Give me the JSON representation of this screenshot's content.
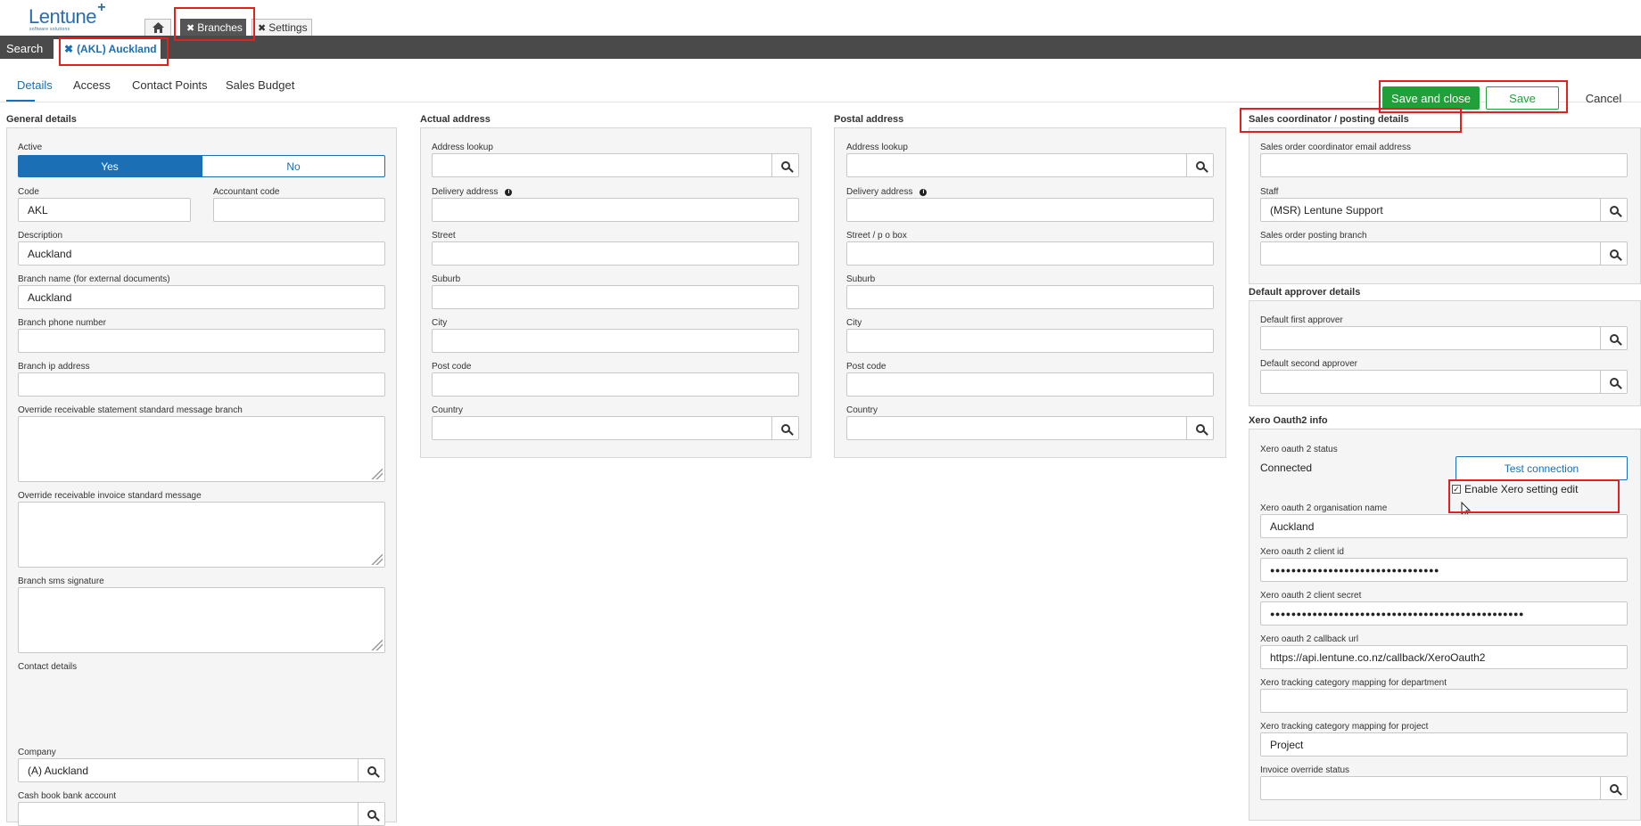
{
  "app": {
    "logo": "Lentune",
    "logo_plus": "+",
    "logo_sub": "software solutions"
  },
  "top_tabs": [
    {
      "label": "Branches"
    },
    {
      "label": "Settings"
    }
  ],
  "bar": {
    "search_label": "Search",
    "open_tab_label": "(AKL) Auckland"
  },
  "subtabs": [
    {
      "label": "Details"
    },
    {
      "label": "Access"
    },
    {
      "label": "Contact Points"
    },
    {
      "label": "Sales Budget"
    }
  ],
  "actions": {
    "save_close": "Save and close",
    "save": "Save",
    "cancel": "Cancel"
  },
  "general": {
    "title": "General details",
    "active_label": "Active",
    "active_yes": "Yes",
    "active_no": "No",
    "active_value": "Yes",
    "code_label": "Code",
    "code_value": "AKL",
    "accountant_code_label": "Accountant code",
    "accountant_code_value": "",
    "description_label": "Description",
    "description_value": "Auckland",
    "branch_name_label": "Branch name (for external documents)",
    "branch_name_value": "Auckland",
    "phone_label": "Branch phone number",
    "ip_label": "Branch ip address",
    "override_statement_label": "Override receivable statement standard message branch",
    "override_invoice_label": "Override receivable invoice standard message",
    "sms_label": "Branch sms signature",
    "contact_details_label": "Contact details",
    "company_label": "Company",
    "company_value": "(A) Auckland",
    "cashbook_label": "Cash book bank account"
  },
  "actual_address": {
    "title": "Actual address",
    "lookup_label": "Address lookup",
    "delivery_label": "Delivery address",
    "street_label": "Street",
    "suburb_label": "Suburb",
    "city_label": "City",
    "postcode_label": "Post code",
    "country_label": "Country"
  },
  "postal_address": {
    "title": "Postal address",
    "lookup_label": "Address lookup",
    "delivery_label": "Delivery address",
    "street_label": "Street / p o box",
    "suburb_label": "Suburb",
    "city_label": "City",
    "postcode_label": "Post code",
    "country_label": "Country"
  },
  "sales_coordinator": {
    "title": "Sales coordinator / posting details",
    "email_label": "Sales order coordinator email address",
    "staff_label": "Staff",
    "staff_value": "(MSR) Lentune Support",
    "posting_branch_label": "Sales order posting branch"
  },
  "approver": {
    "title": "Default approver details",
    "first_label": "Default first approver",
    "second_label": "Default second approver"
  },
  "xero": {
    "title": "Xero Oauth2 info",
    "status_label": "Xero oauth 2 status",
    "status_value": "Connected",
    "test_button": "Test connection",
    "enable_edit_label": "Enable Xero setting edit",
    "enable_edit_checked": true,
    "org_name_label": "Xero oauth 2 organisation name",
    "org_name_value": "Auckland",
    "client_id_label": "Xero oauth 2 client id",
    "client_id_value": "●●●●●●●●●●●●●●●●●●●●●●●●●●●●●●●●",
    "client_secret_label": "Xero oauth 2 client secret",
    "client_secret_value": "●●●●●●●●●●●●●●●●●●●●●●●●●●●●●●●●●●●●●●●●●●●●●●●●",
    "callback_label": "Xero oauth 2 callback url",
    "callback_value": "https://api.lentune.co.nz/callback/XeroOauth2",
    "tracking_dept_label": "Xero tracking category mapping for department",
    "tracking_project_label": "Xero tracking category mapping for project",
    "tracking_project_value": "Project",
    "invoice_override_label": "Invoice override status"
  },
  "colors": {
    "accent": "#1a6fb5",
    "success": "#21a03a",
    "highlight": "#e32020",
    "bar": "#4a4a4a"
  }
}
